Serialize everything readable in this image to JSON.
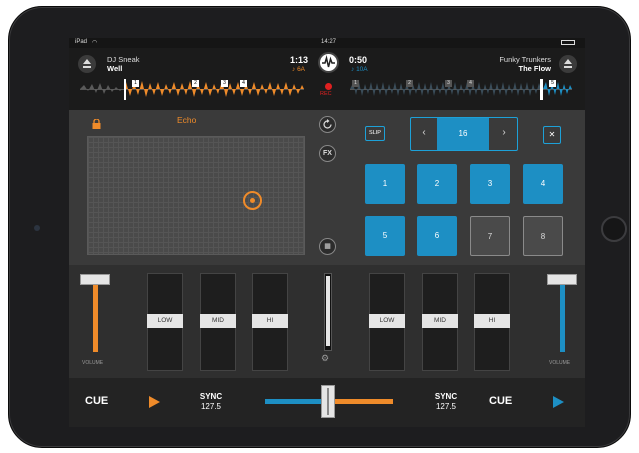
{
  "status_bar": {
    "device": "iPad",
    "time": "14:27"
  },
  "deck_left": {
    "artist": "DJ Sneak",
    "title": "Well",
    "time": "1:13",
    "key": "6A",
    "cues": [
      "1",
      "2",
      "3",
      "4"
    ]
  },
  "deck_right": {
    "artist": "Funky Trunkers",
    "title": "The Flow",
    "time": "0:50",
    "key": "10A",
    "cues": [
      "1",
      "2",
      "3",
      "4",
      "5"
    ]
  },
  "record_label": "REC",
  "fx": {
    "name": "Echo",
    "fx_button": "FX"
  },
  "loop": {
    "slip_label": "SLIP",
    "value": "16",
    "prev_icon": "‹",
    "next_icon": "›",
    "close_icon": "✕"
  },
  "pads": [
    {
      "label": "1",
      "active": true
    },
    {
      "label": "2",
      "active": true
    },
    {
      "label": "3",
      "active": true
    },
    {
      "label": "4",
      "active": true
    },
    {
      "label": "5",
      "active": true
    },
    {
      "label": "6",
      "active": true
    },
    {
      "label": "7",
      "active": false
    },
    {
      "label": "8",
      "active": false
    }
  ],
  "mixer": {
    "volume_label": "VOLUME",
    "eq_left": [
      "LOW",
      "MID",
      "HI"
    ],
    "eq_right": [
      "LOW",
      "MID",
      "HI"
    ]
  },
  "transport": {
    "left_cue": "CUE",
    "right_cue": "CUE",
    "left_sync_label": "SYNC",
    "left_bpm": "127.5",
    "right_sync_label": "SYNC",
    "right_bpm": "127.5"
  },
  "colors": {
    "deck_a": "#ef8b2a",
    "deck_b": "#1d8fc4",
    "record": "#e02020"
  }
}
